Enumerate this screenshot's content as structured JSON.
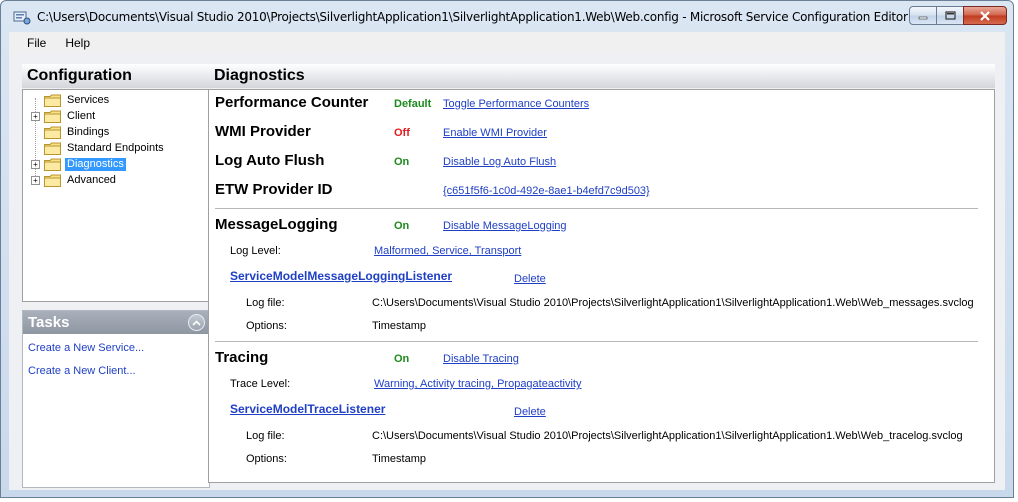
{
  "window": {
    "title": "C:\\Users\\Documents\\Visual Studio 2010\\Projects\\SilverlightApplication1\\SilverlightApplication1.Web\\Web.config - Microsoft Service Configuration Editor"
  },
  "menu": {
    "file": "File",
    "help": "Help"
  },
  "configuration": {
    "header": "Configuration",
    "tree": [
      {
        "label": "Services",
        "expandable": false
      },
      {
        "label": "Client",
        "expandable": true
      },
      {
        "label": "Bindings",
        "expandable": false
      },
      {
        "label": "Standard Endpoints",
        "expandable": false
      },
      {
        "label": "Diagnostics",
        "expandable": true,
        "selected": true
      },
      {
        "label": "Advanced",
        "expandable": true
      }
    ]
  },
  "tasks": {
    "header": "Tasks",
    "links": [
      "Create a New Service...",
      "Create a New Client..."
    ]
  },
  "diagnostics": {
    "header": "Diagnostics",
    "performance_counter": {
      "name": "Performance Counter",
      "status": "Default",
      "link": "Toggle Performance Counters"
    },
    "wmi_provider": {
      "name": "WMI Provider",
      "status": "Off",
      "link": "Enable WMI Provider"
    },
    "log_auto_flush": {
      "name": "Log Auto Flush",
      "status": "On",
      "link": "Disable Log Auto Flush"
    },
    "etw_provider": {
      "name": "ETW Provider ID",
      "link": "{c651f5f6-1c0d-492e-8ae1-b4efd7c9d503}"
    },
    "message_logging": {
      "name": "MessageLogging",
      "status": "On",
      "link": "Disable MessageLogging",
      "level_label": "Log Level:",
      "level_value": "Malformed, Service, Transport",
      "listener": "ServiceModelMessageLoggingListener",
      "delete": "Delete",
      "log_file_label": "Log file:",
      "log_file_value": "C:\\Users\\Documents\\Visual Studio 2010\\Projects\\SilverlightApplication1\\SilverlightApplication1.Web\\Web_messages.svclog",
      "options_label": "Options:",
      "options_value": "Timestamp"
    },
    "tracing": {
      "name": "Tracing",
      "status": "On",
      "link": "Disable Tracing",
      "level_label": "Trace Level:",
      "level_value": "Warning, Activity tracing, Propagateactivity",
      "listener": "ServiceModelTraceListener",
      "delete": "Delete",
      "log_file_label": "Log file:",
      "log_file_value": "C:\\Users\\Documents\\Visual Studio 2010\\Projects\\SilverlightApplication1\\SilverlightApplication1.Web\\Web_tracelog.svclog",
      "options_label": "Options:",
      "options_value": "Timestamp"
    }
  }
}
